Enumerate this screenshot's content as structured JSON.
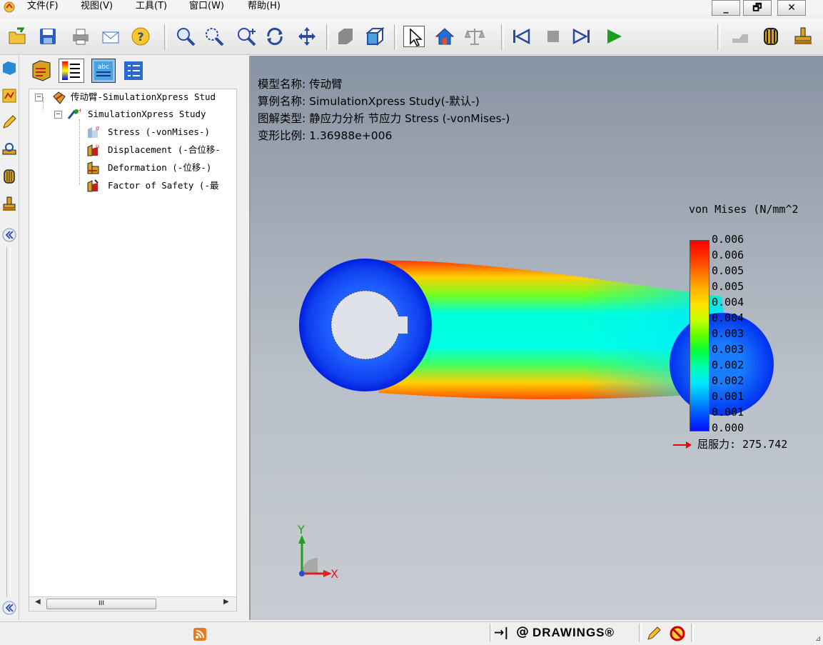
{
  "menu": {
    "items": [
      "文件(F)",
      "视图(V)",
      "工具(T)",
      "窗口(W)",
      "帮助(H)"
    ],
    "window_buttons": {
      "minimize": "_",
      "restore": "🗗",
      "close": "✕"
    }
  },
  "toolbar": {
    "icons": [
      "open-icon",
      "save-icon",
      "print-icon",
      "email-icon",
      "help-icon",
      "zoom-fit-icon",
      "zoom-area-icon",
      "zoom-in-out-icon",
      "rotate-icon",
      "pan-icon",
      "shaded-icon",
      "isometric-icon",
      "select-icon",
      "home-icon",
      "balance-icon",
      "first-frame-icon",
      "stop-icon",
      "next-frame-icon",
      "play-icon",
      "measure-icon",
      "section-icon",
      "stamp-icon"
    ]
  },
  "tree": {
    "root": "传动臂-SimulationXpress Stud",
    "study": "SimulationXpress Study",
    "results": [
      {
        "label": "Stress (-vonMises-)"
      },
      {
        "label": "Displacement (-合位移-"
      },
      {
        "label": "Deformation (-位移-)"
      },
      {
        "label": "Factor of Safety (-最"
      }
    ],
    "scroll_thumb": "III"
  },
  "viewport": {
    "info": {
      "model_name": "模型名称: 传动臂",
      "study_name": "算例名称: SimulationXpress Study(-默认-)",
      "plot_type": "图解类型: 静应力分析 节应力 Stress (-vonMises-)",
      "deformation_scale": "变形比例: 1.36988e+006"
    },
    "legend": {
      "title": "von Mises (N/mm^2",
      "labels": [
        "0.006",
        "0.006",
        "0.005",
        "0.005",
        "0.004",
        "0.004",
        "0.003",
        "0.003",
        "0.002",
        "0.002",
        "0.001",
        "0.001",
        "0.000"
      ],
      "yield": "屈服力: 275.742",
      "colors": [
        "#ff0000",
        "#ff3000",
        "#ff7000",
        "#ffb000",
        "#ffe000",
        "#c8ff00",
        "#60ff00",
        "#00ff40",
        "#00ffb0",
        "#00e8ff",
        "#00a0ff",
        "#0050ff",
        "#0010ff"
      ]
    },
    "axes": {
      "y": "Y",
      "x": "X"
    }
  },
  "status": {
    "drawings_label": "DRAWINGS®",
    "arrow_label": "→|"
  }
}
